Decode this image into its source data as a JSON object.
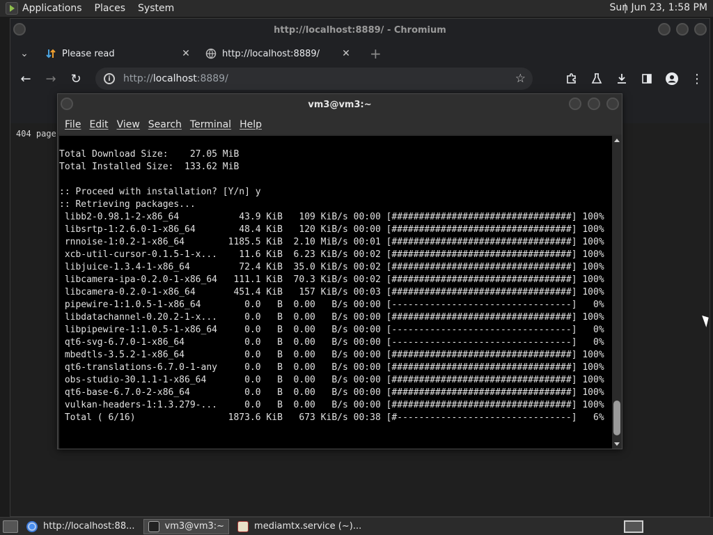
{
  "top_panel": {
    "menus": [
      "Applications",
      "Places",
      "System"
    ],
    "clock": "Sun Jun 23,  1:58 PM"
  },
  "browser": {
    "title": "http://localhost:8889/ - Chromium",
    "tabs": [
      {
        "title": "Please read",
        "icon": "transfer-arrows-icon"
      },
      {
        "title": "http://localhost:8889/",
        "icon": "globe-icon"
      }
    ],
    "new_tab_symbol": "+",
    "omnibox": {
      "scheme": "http://",
      "host": "localhost",
      "rest": ":8889/"
    },
    "page_text": "404 page"
  },
  "terminal": {
    "title": "vm3@vm3:~",
    "menus": [
      "File",
      "Edit",
      "View",
      "Search",
      "Terminal",
      "Help"
    ],
    "lines": [
      "Total Download Size:    27.05 MiB",
      "Total Installed Size:  133.62 MiB",
      "",
      ":: Proceed with installation? [Y/n] y",
      ":: Retrieving packages...",
      " libb2-0.98.1-2-x86_64           43.9 KiB   109 KiB/s 00:00 [#################################] 100%",
      " libsrtp-1:2.6.0-1-x86_64        48.4 KiB   120 KiB/s 00:00 [#################################] 100%",
      " rnnoise-1:0.2-1-x86_64        1185.5 KiB  2.10 MiB/s 00:01 [#################################] 100%",
      " xcb-util-cursor-0.1.5-1-x...    11.6 KiB  6.23 KiB/s 00:02 [#################################] 100%",
      " libjuice-1.3.4-1-x86_64         72.4 KiB  35.0 KiB/s 00:02 [#################################] 100%",
      " libcamera-ipa-0.2.0-1-x86_64   111.1 KiB  70.3 KiB/s 00:02 [#################################] 100%",
      " libcamera-0.2.0-1-x86_64       451.4 KiB   157 KiB/s 00:03 [#################################] 100%",
      " pipewire-1:1.0.5-1-x86_64        0.0   B  0.00   B/s 00:00 [---------------------------------]   0%",
      " libdatachannel-0.20.2-1-x...     0.0   B  0.00   B/s 00:00 [#################################] 100%",
      " libpipewire-1:1.0.5-1-x86_64     0.0   B  0.00   B/s 00:00 [---------------------------------]   0%",
      " qt6-svg-6.7.0-1-x86_64           0.0   B  0.00   B/s 00:00 [---------------------------------]   0%",
      " mbedtls-3.5.2-1-x86_64           0.0   B  0.00   B/s 00:00 [#################################] 100%",
      " qt6-translations-6.7.0-1-any     0.0   B  0.00   B/s 00:00 [#################################] 100%",
      " obs-studio-30.1.1-1-x86_64       0.0   B  0.00   B/s 00:00 [#################################] 100%",
      " qt6-base-6.7.0-2-x86_64          0.0   B  0.00   B/s 00:00 [#################################] 100%",
      " vulkan-headers-1:1.3.279-...     0.0   B  0.00   B/s 00:00 [#################################] 100%",
      " Total ( 6/16)                 1873.6 KiB   673 KiB/s 00:38 [#--------------------------------]   6%"
    ]
  },
  "taskbar": {
    "items": [
      {
        "label": "http://localhost:88...",
        "icon": "chromium-icon"
      },
      {
        "label": "vm3@vm3:~",
        "icon": "terminal-icon"
      },
      {
        "label": "mediamtx.service (~)...",
        "icon": "text-editor-icon"
      }
    ]
  }
}
